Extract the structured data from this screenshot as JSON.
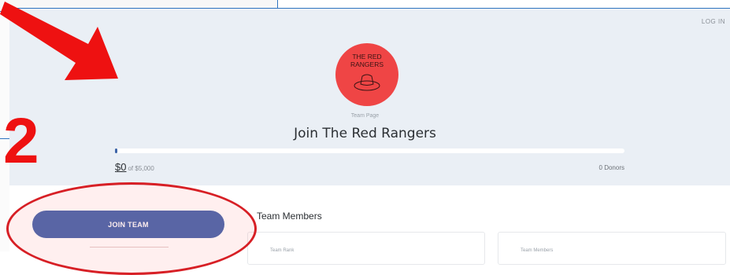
{
  "header": {
    "login_label": "LOG IN"
  },
  "team": {
    "logo_line1": "THE RED",
    "logo_line2": "RANGERS",
    "page_type": "Team Page",
    "title": "Join The Red Rangers",
    "raised": "$0",
    "goal": "of $5,000",
    "donors": "0 Donors",
    "progress_fraction": 0.005
  },
  "sidebar": {
    "join_button_label": "JOIN TEAM"
  },
  "members": {
    "section_title": "Team Members",
    "cards": [
      {
        "label": "Team Rank"
      },
      {
        "label": "Team Members"
      }
    ]
  },
  "annotation": {
    "step_number": "2"
  },
  "colors": {
    "accent": "#3d5da8",
    "logo": "#ef4545",
    "annotation": "#ee1111",
    "hero_bg": "#eaeff5"
  }
}
